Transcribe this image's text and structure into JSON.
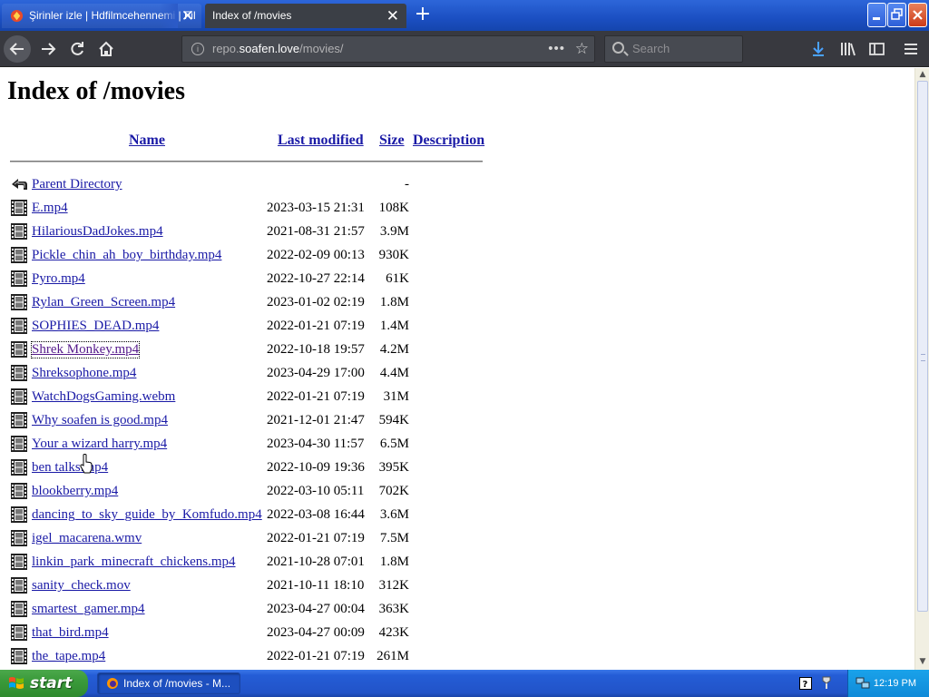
{
  "browser": {
    "tabs": [
      {
        "label": "Şirinler izle | Hdfilmcehennemi | Fil",
        "active": false
      },
      {
        "label": "Index of /movies",
        "active": true
      }
    ],
    "new_tab_symbol": "+",
    "close_symbol": "✕",
    "url": {
      "prefix": "repo.",
      "host": "soafen.love",
      "path": "/movies/"
    },
    "search_placeholder": "Search"
  },
  "page": {
    "title": "Index of /movies",
    "columns": {
      "name": "Name",
      "last_modified": "Last modified",
      "size": "Size",
      "description": "Description"
    },
    "parent": {
      "label": "Parent Directory",
      "size": "-"
    },
    "files": [
      {
        "name": "E.mp4",
        "modified": "2023-03-15 21:31",
        "size": "108K"
      },
      {
        "name": "HilariousDadJokes.mp4",
        "modified": "2021-08-31 21:57",
        "size": "3.9M"
      },
      {
        "name": "Pickle_chin_ah_boy_birthday.mp4",
        "modified": "2022-02-09 00:13",
        "size": "930K"
      },
      {
        "name": "Pyro.mp4",
        "modified": "2022-10-27 22:14",
        "size": "61K"
      },
      {
        "name": "Rylan_Green_Screen.mp4",
        "modified": "2023-01-02 02:19",
        "size": "1.8M"
      },
      {
        "name": "SOPHIES_DEAD.mp4",
        "modified": "2022-01-21 07:19",
        "size": "1.4M"
      },
      {
        "name": "Shrek Monkey.mp4",
        "modified": "2022-10-18 19:57",
        "size": "4.2M"
      },
      {
        "name": "Shreksophone.mp4",
        "modified": "2023-04-29 17:00",
        "size": "4.4M"
      },
      {
        "name": "WatchDogsGaming.webm",
        "modified": "2022-01-21 07:19",
        "size": "31M"
      },
      {
        "name": "Why soafen is good.mp4",
        "modified": "2021-12-01 21:47",
        "size": "594K"
      },
      {
        "name": "Your a wizard harry.mp4",
        "modified": "2023-04-30 11:57",
        "size": "6.5M"
      },
      {
        "name": "ben talks.mp4",
        "modified": "2022-10-09 19:36",
        "size": "395K"
      },
      {
        "name": "blookberry.mp4",
        "modified": "2022-03-10 05:11",
        "size": "702K"
      },
      {
        "name": "dancing_to_sky_guide_by_Komfudo.mp4",
        "modified": "2022-03-08 16:44",
        "size": "3.6M"
      },
      {
        "name": "igel_macarena.wmv",
        "modified": "2022-01-21 07:19",
        "size": "7.5M"
      },
      {
        "name": "linkin_park_minecraft_chickens.mp4",
        "modified": "2021-10-28 07:01",
        "size": "1.8M"
      },
      {
        "name": "sanity_check.mov",
        "modified": "2021-10-11 18:10",
        "size": "312K"
      },
      {
        "name": "smartest_gamer.mp4",
        "modified": "2023-04-27 00:04",
        "size": "363K"
      },
      {
        "name": "that_bird.mp4",
        "modified": "2023-04-27 00:09",
        "size": "423K"
      },
      {
        "name": "the_tape.mp4",
        "modified": "2022-01-21 07:19",
        "size": "261M"
      }
    ]
  },
  "taskbar": {
    "start_label": "start",
    "task_label": "Index of /movies - M...",
    "clock": "12:19 PM"
  },
  "colors": {
    "link": "#1a1aa6",
    "visited": "#551a8b",
    "taskbar": "#245dd6",
    "nav": "#38393f"
  }
}
